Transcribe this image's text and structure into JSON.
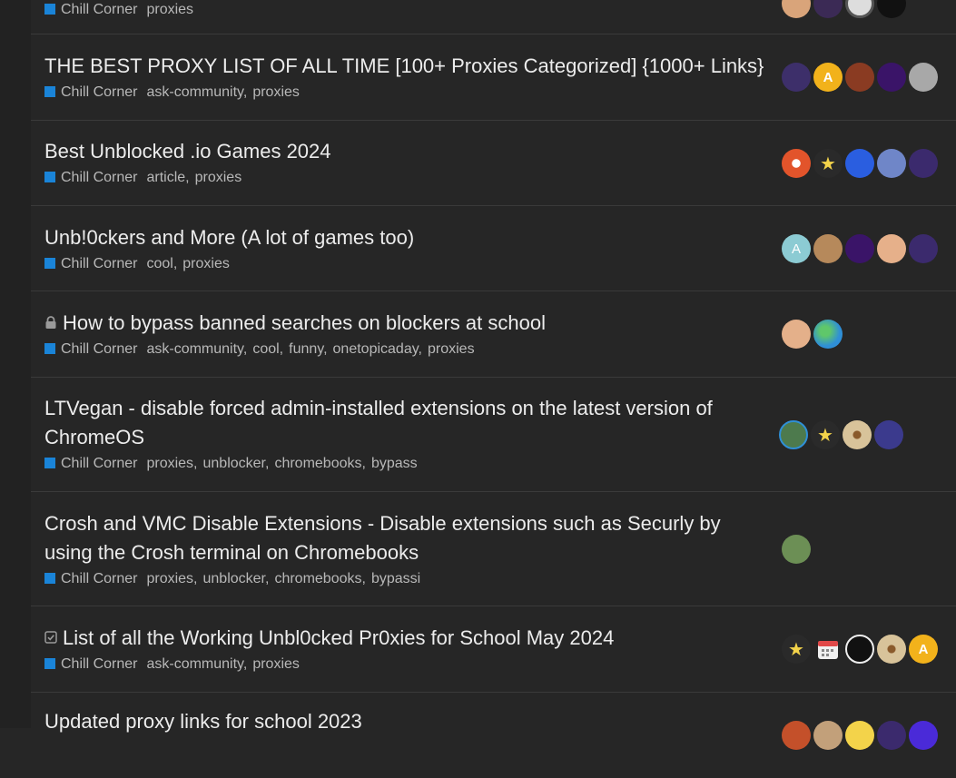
{
  "topics": [
    {
      "title": "",
      "category": "Chill Corner",
      "tags": [
        "proxies"
      ],
      "avatars": [
        {
          "icon": "avatar-photo-icon",
          "color": "#d9a47a",
          "letter": ""
        },
        {
          "icon": "avatar-photo-icon",
          "color": "#3b2a55",
          "letter": ""
        },
        {
          "icon": "avatar-photo-icon",
          "color": "#dddddd",
          "letter": ""
        },
        {
          "icon": "avatar-photo-icon",
          "color": "#111111",
          "letter": ""
        }
      ]
    },
    {
      "title": "THE BEST PROXY LIST OF ALL TIME [100+ Proxies Categorized] {1000+ Links}",
      "category": "Chill Corner",
      "tags": [
        "ask-community",
        "proxies"
      ],
      "avatars": [
        {
          "icon": "avatar-photo-icon",
          "color": "#3d2f6a",
          "letter": ""
        },
        {
          "icon": "avatar-letter-icon",
          "color": "#f2b21b",
          "letter": "A"
        },
        {
          "icon": "avatar-photo-icon",
          "color": "#8a3b22",
          "letter": ""
        },
        {
          "icon": "avatar-photo-icon",
          "color": "#3a1468",
          "letter": ""
        },
        {
          "icon": "avatar-photo-icon",
          "color": "#a8a8a8",
          "letter": ""
        }
      ]
    },
    {
      "title": "Best Unblocked .io Games 2024",
      "category": "Chill Corner",
      "tags": [
        "article",
        "proxies"
      ],
      "avatars": [
        {
          "icon": "avatar-photo-icon",
          "color": "#e2542b",
          "letter": ""
        },
        {
          "icon": "avatar-photo-icon",
          "color": "#f3d34a",
          "letter": ""
        },
        {
          "icon": "avatar-photo-icon",
          "color": "#2a5ee0",
          "letter": ""
        },
        {
          "icon": "avatar-photo-icon",
          "color": "#6f86c8",
          "letter": ""
        },
        {
          "icon": "avatar-photo-icon",
          "color": "#3b2a6d",
          "letter": ""
        }
      ]
    },
    {
      "title": "Unb!0ckers and More (A lot of games too)",
      "category": "Chill Corner",
      "tags": [
        "cool",
        "proxies"
      ],
      "avatars": [
        {
          "icon": "avatar-letter-icon",
          "color": "#8ccbd3",
          "letter": "A"
        },
        {
          "icon": "avatar-photo-icon",
          "color": "#b6895b",
          "letter": ""
        },
        {
          "icon": "avatar-photo-icon",
          "color": "#3a1468",
          "letter": ""
        },
        {
          "icon": "avatar-photo-icon",
          "color": "#e6b08a",
          "letter": ""
        },
        {
          "icon": "avatar-photo-icon",
          "color": "#3b2a6d",
          "letter": ""
        }
      ]
    },
    {
      "title": "How to bypass banned searches on blockers at school",
      "title_icon": "lock-icon",
      "category": "Chill Corner",
      "tags": [
        "ask-community",
        "cool",
        "funny",
        "onetopicaday",
        "proxies"
      ],
      "avatars": [
        {
          "icon": "avatar-photo-icon",
          "color": "#e4b08a",
          "letter": ""
        },
        {
          "icon": "avatar-photo-icon",
          "color": "#2f8fd6",
          "letter": ""
        }
      ]
    },
    {
      "title": "LTVegan - disable forced admin-installed extensions on the latest version of ChromeOS",
      "category": "Chill Corner",
      "tags": [
        "proxies",
        "unblocker",
        "chromebooks",
        "bypass"
      ],
      "avatars": [
        {
          "icon": "avatar-photo-icon",
          "color": "#4d7a4d",
          "letter": ""
        },
        {
          "icon": "avatar-photo-icon",
          "color": "#f3d34a",
          "letter": ""
        },
        {
          "icon": "avatar-photo-icon",
          "color": "#d8c39a",
          "letter": ""
        },
        {
          "icon": "avatar-photo-icon",
          "color": "#3b3a8d",
          "letter": ""
        }
      ]
    },
    {
      "title": "Crosh and VMC Disable Extensions - Disable extensions such as Securly by using the Crosh terminal on Chromebooks",
      "category": "Chill Corner",
      "tags": [
        "proxies",
        "unblocker",
        "chromebooks",
        "bypassi"
      ],
      "avatars": [
        {
          "icon": "avatar-photo-icon",
          "color": "#6c8f55",
          "letter": ""
        }
      ]
    },
    {
      "title": "List of all the Working Unbl0cked Pr0xies for School May 2024",
      "title_icon": "solved-checkbox-icon",
      "category": "Chill Corner",
      "tags": [
        "ask-community",
        "proxies"
      ],
      "avatars": [
        {
          "icon": "avatar-photo-icon",
          "color": "#f3d34a",
          "letter": ""
        },
        {
          "icon": "calendar-icon",
          "color": "#e6e6e6",
          "letter": ""
        },
        {
          "icon": "avatar-photo-icon",
          "color": "#111111",
          "letter": ""
        },
        {
          "icon": "avatar-photo-icon",
          "color": "#d8c39a",
          "letter": ""
        },
        {
          "icon": "avatar-letter-icon",
          "color": "#f2b21b",
          "letter": "A"
        }
      ]
    },
    {
      "title": "Updated proxy links for school 2023",
      "category": "",
      "tags": [],
      "avatars": [
        {
          "icon": "avatar-photo-icon",
          "color": "#c4502a",
          "letter": ""
        },
        {
          "icon": "avatar-photo-icon",
          "color": "#c2a07a",
          "letter": ""
        },
        {
          "icon": "avatar-photo-icon",
          "color": "#f3d34a",
          "letter": ""
        },
        {
          "icon": "avatar-photo-icon",
          "color": "#3b2a6d",
          "letter": ""
        },
        {
          "icon": "avatar-photo-icon",
          "color": "#4a2ad8",
          "letter": ""
        }
      ]
    }
  ]
}
